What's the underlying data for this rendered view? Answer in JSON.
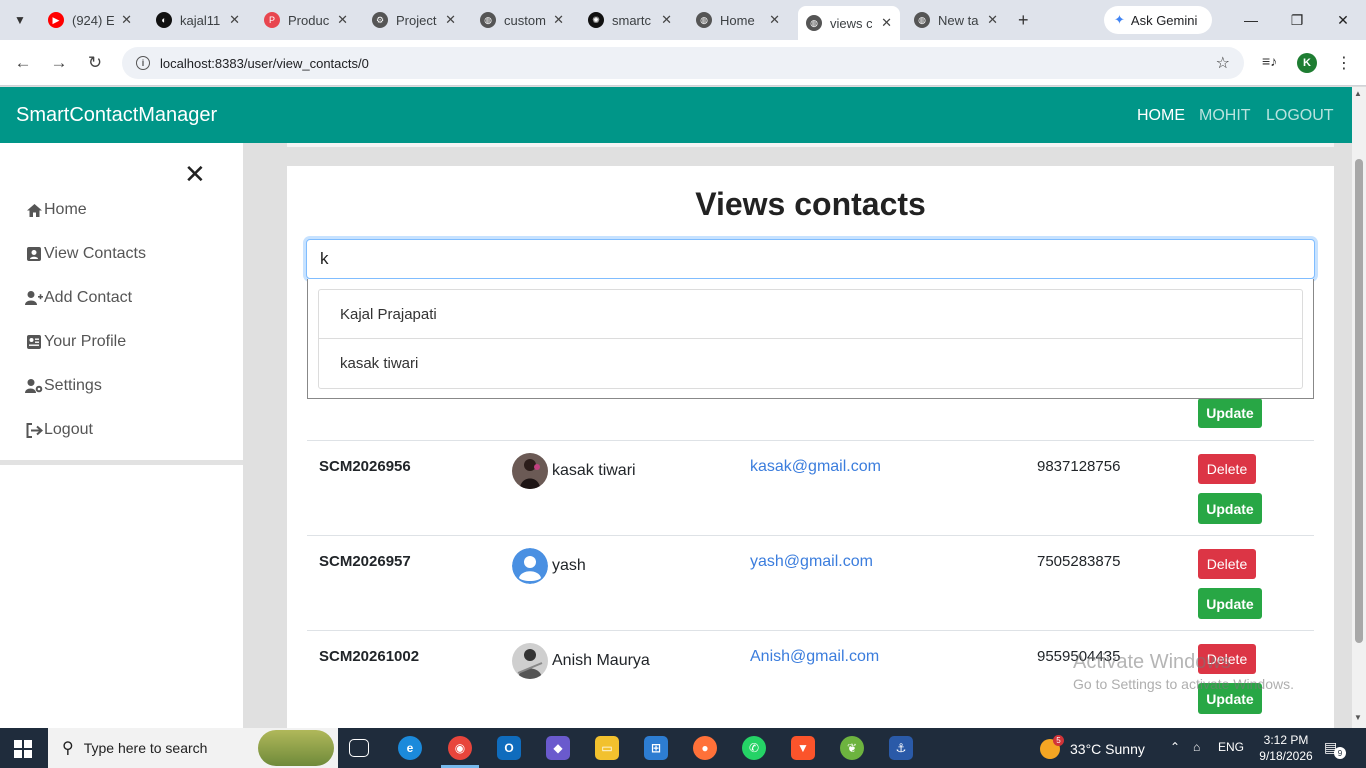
{
  "browser": {
    "tabs": [
      {
        "title": "(924) E",
        "favicon": "youtube-icon",
        "color": "#ff0000"
      },
      {
        "title": "kajal11",
        "favicon": "github-icon",
        "color": "#111111"
      },
      {
        "title": "Produc",
        "favicon": "producthunt-icon",
        "color": "#e8464f"
      },
      {
        "title": "Project",
        "favicon": "gear-icon",
        "color": "#555555"
      },
      {
        "title": "custom",
        "favicon": "globe-icon",
        "color": "#555555"
      },
      {
        "title": "smartc",
        "favicon": "chatgpt-icon",
        "color": "#111111"
      },
      {
        "title": "Home",
        "favicon": "globe-icon",
        "color": "#555555"
      },
      {
        "title": "views c",
        "favicon": "globe-icon",
        "color": "#555555",
        "active": true
      },
      {
        "title": "New ta",
        "favicon": "globe-icon",
        "color": "#555555"
      }
    ],
    "gemini_label": "Ask Gemini",
    "url": "localhost:8383/user/view_contacts/0",
    "profile_initial": "K"
  },
  "app": {
    "brand": "SmartContactManager",
    "nav": [
      {
        "label": "HOME",
        "active": true
      },
      {
        "label": "MOHIT",
        "active": false
      },
      {
        "label": "LOGOUT",
        "active": false
      }
    ]
  },
  "sidebar": {
    "items": [
      {
        "label": "Home",
        "icon": "home-icon"
      },
      {
        "label": "View Contacts",
        "icon": "address-book-icon"
      },
      {
        "label": "Add Contact",
        "icon": "user-plus-icon"
      },
      {
        "label": "Your Profile",
        "icon": "id-card-icon"
      },
      {
        "label": "Settings",
        "icon": "user-cog-icon"
      },
      {
        "label": "Logout",
        "icon": "sign-out-icon"
      }
    ]
  },
  "main": {
    "title": "Views contacts",
    "search_value": "k",
    "suggestions": [
      "Kajal Prajapati",
      "kasak tiwari"
    ],
    "update_label": "Update",
    "delete_label": "Delete",
    "contacts": [
      {
        "id": "SCM2026956",
        "name": "kasak tiwari",
        "email": "kasak@gmail.com",
        "phone": "9837128756",
        "photo": "photo"
      },
      {
        "id": "SCM2026957",
        "name": "yash",
        "email": "yash@gmail.com",
        "phone": "7505283875",
        "photo": "default-avatar"
      },
      {
        "id": "SCM20261002",
        "name": "Anish Maurya",
        "email": "Anish@gmail.com",
        "phone": "9559504435",
        "photo": "photo"
      }
    ]
  },
  "watermark": {
    "line1": "Activate Windows",
    "line2": "Go to Settings to activate Windows."
  },
  "taskbar": {
    "search_placeholder": "Type here to search",
    "weather": "33°C  Sunny",
    "weather_badge": "5",
    "lang": "ENG",
    "time": "3:12 PM",
    "date": "9/18/2026",
    "notifications": "9"
  }
}
